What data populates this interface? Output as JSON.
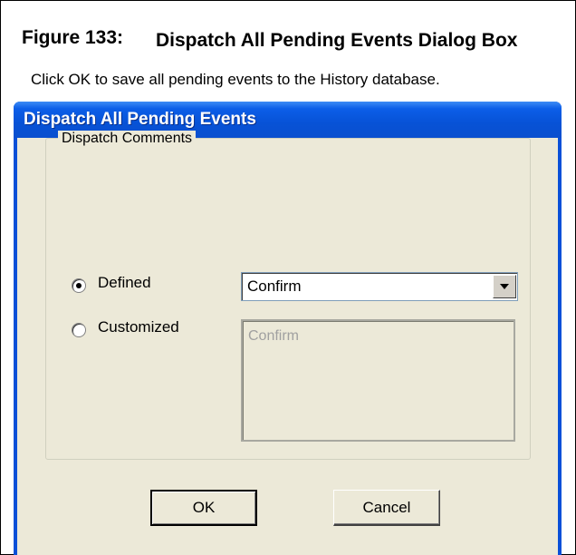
{
  "figure": {
    "label": "Figure 133:",
    "title": "Dispatch All Pending Events Dialog Box"
  },
  "dialog": {
    "title": "Dispatch All Pending Events",
    "message": "Click OK to save all pending events to the History database.",
    "group": {
      "label": "Dispatch Comments",
      "options": [
        {
          "label": "Defined",
          "selected": true
        },
        {
          "label": "Customized",
          "selected": false
        }
      ],
      "defined_value": "Confirm",
      "custom_text": "Confirm",
      "custom_text_disabled": true
    },
    "buttons": {
      "ok": "OK",
      "cancel": "Cancel"
    }
  },
  "colors": {
    "titlebar": "#0752d6",
    "client": "#ece9d8"
  }
}
